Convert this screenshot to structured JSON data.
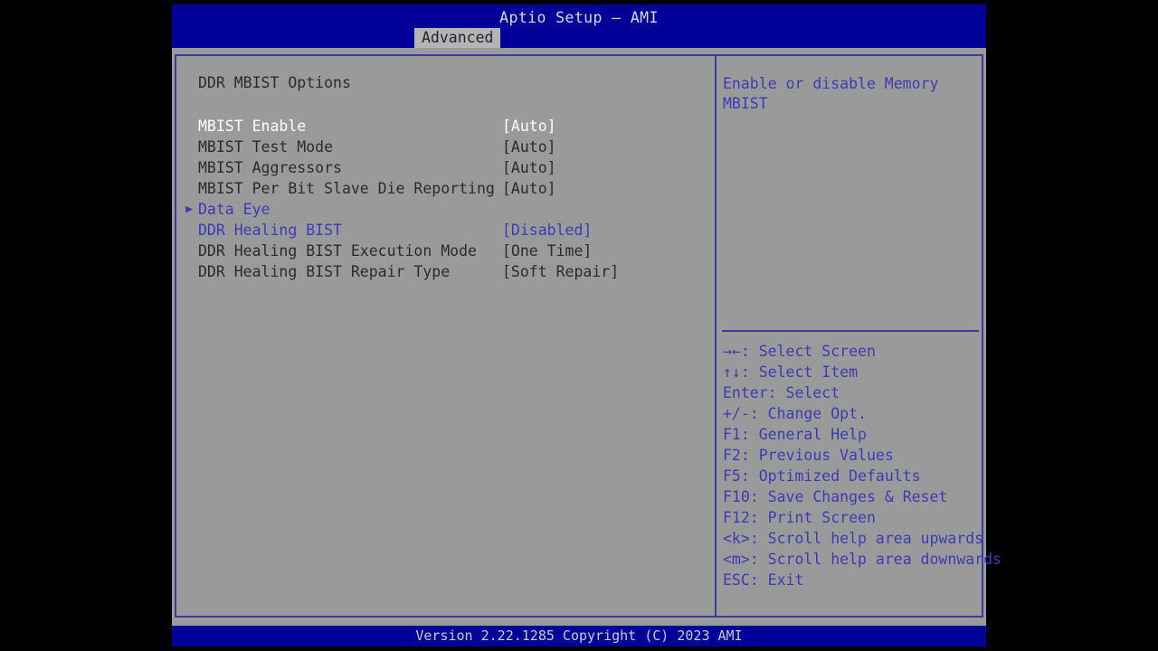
{
  "header": {
    "title": "Aptio Setup – AMI",
    "tabs": [
      {
        "label": "Advanced",
        "active": true
      }
    ]
  },
  "main": {
    "section_title": "DDR MBIST Options",
    "options": [
      {
        "label": "MBIST Enable",
        "value": "[Auto]",
        "state": "selected",
        "marker": ""
      },
      {
        "label": "MBIST Test Mode",
        "value": "[Auto]",
        "state": "normal",
        "marker": ""
      },
      {
        "label": "MBIST Aggressors",
        "value": "[Auto]",
        "state": "normal",
        "marker": ""
      },
      {
        "label": "MBIST Per Bit Slave Die Reporting",
        "value": "[Auto]",
        "state": "normal",
        "marker": ""
      },
      {
        "label": "Data Eye",
        "value": "",
        "state": "link",
        "marker": "▶"
      },
      {
        "label": "DDR Healing BIST",
        "value": "[Disabled]",
        "state": "link",
        "marker": ""
      },
      {
        "label": "DDR Healing BIST Execution Mode",
        "value": "[One Time]",
        "state": "normal",
        "marker": ""
      },
      {
        "label": "DDR Healing BIST Repair Type",
        "value": "[Soft Repair]",
        "state": "normal",
        "marker": ""
      }
    ]
  },
  "help": {
    "description": "Enable or disable Memory MBIST",
    "legend": [
      {
        "key": "→←",
        "text": ": Select Screen"
      },
      {
        "key": "↑↓",
        "text": ": Select Item"
      },
      {
        "key": "Enter",
        "text": ": Select"
      },
      {
        "key": "+/-",
        "text": ": Change Opt."
      },
      {
        "key": "F1",
        "text": ": General Help"
      },
      {
        "key": "F2",
        "text": ": Previous Values"
      },
      {
        "key": "F5",
        "text": ": Optimized Defaults"
      },
      {
        "key": "F10",
        "text": ": Save Changes & Reset"
      },
      {
        "key": "F12",
        "text": ": Print Screen"
      },
      {
        "key": "<k>",
        "text": ": Scroll help area upwards"
      },
      {
        "key": "<m>",
        "text": ": Scroll help area downwards"
      },
      {
        "key": "ESC",
        "text": ": Exit"
      }
    ]
  },
  "footer": {
    "version_text": "Version 2.22.1285 Copyright (C) 2023 AMI"
  },
  "colors": {
    "background_gray": "#9a9a9a",
    "bar_blue": "#000099",
    "accent_blue": "#3b3bb4",
    "border_blue": "#3b3b9e",
    "selected_text": "#ffffff",
    "normal_text": "#2b2b2b"
  }
}
